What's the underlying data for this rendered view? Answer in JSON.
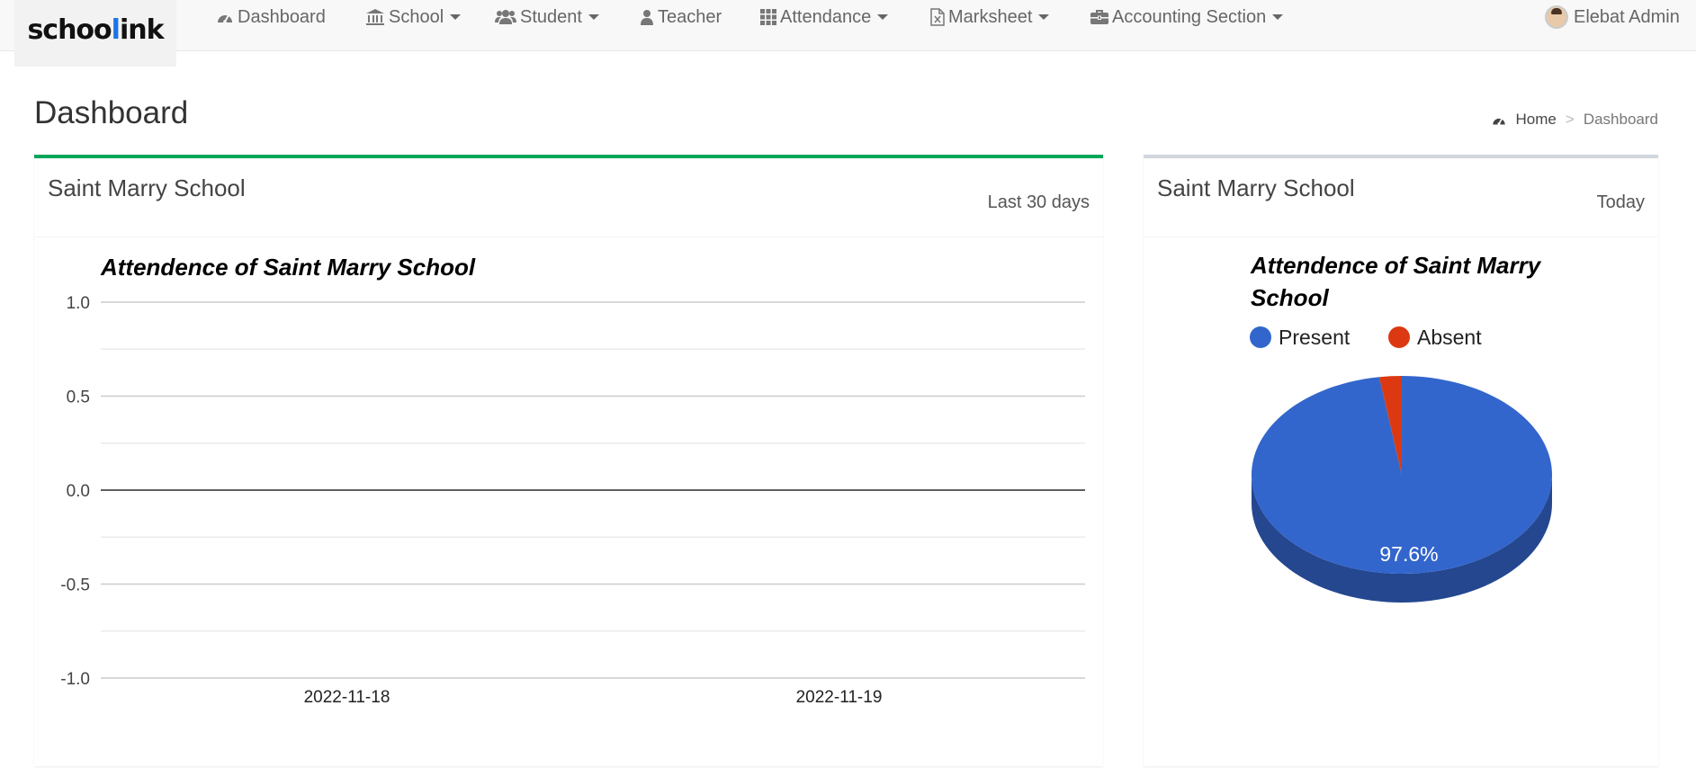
{
  "brand": {
    "prefix": "schoo",
    "accent": "l",
    "suffix": "ink",
    "accent_color": "#1e73e8"
  },
  "nav": {
    "items": [
      {
        "label": "Dashboard",
        "icon": "dashboard-icon",
        "dropdown": false
      },
      {
        "label": "School",
        "icon": "institution-icon",
        "dropdown": true
      },
      {
        "label": "Student",
        "icon": "users-icon",
        "dropdown": true
      },
      {
        "label": "Teacher",
        "icon": "user-icon",
        "dropdown": false
      },
      {
        "label": "Attendance",
        "icon": "grid-icon",
        "dropdown": true
      },
      {
        "label": "Marksheet",
        "icon": "file-excel-icon",
        "dropdown": true
      },
      {
        "label": "Accounting Section",
        "icon": "briefcase-icon",
        "dropdown": true
      }
    ],
    "user": {
      "name": "Elebat Admin",
      "icon": "avatar"
    }
  },
  "page": {
    "title": "Dashboard"
  },
  "breadcrumb": {
    "home": "Home",
    "separator": ">",
    "current": "Dashboard"
  },
  "left_box": {
    "title": "Saint Marry School",
    "range": "Last 30 days",
    "accent_color": "#00a65a"
  },
  "right_box": {
    "title": "Saint Marry School",
    "range": "Today",
    "accent_color": "#d2d6de"
  },
  "chart_data": [
    {
      "type": "line",
      "title": "Attendence of Saint Marry School",
      "categories": [
        "2022-11-18",
        "2022-11-19"
      ],
      "series": [
        {
          "values": [
            0,
            0
          ]
        }
      ],
      "ylim": [
        -1.0,
        1.0
      ],
      "yticks": [
        "1.0",
        "0.5",
        "0.0",
        "-0.5",
        "-1.0"
      ],
      "grid": true,
      "legend": "none"
    },
    {
      "type": "pie",
      "title_lines": [
        "Attendence of Saint Marry",
        "School"
      ],
      "labels": [
        "Present",
        "Absent"
      ],
      "values": [
        97.6,
        2.4
      ],
      "colors": [
        "#3366cc",
        "#dc3912"
      ],
      "slice_label": "97.6%",
      "is3D": true,
      "legend": "top"
    }
  ]
}
